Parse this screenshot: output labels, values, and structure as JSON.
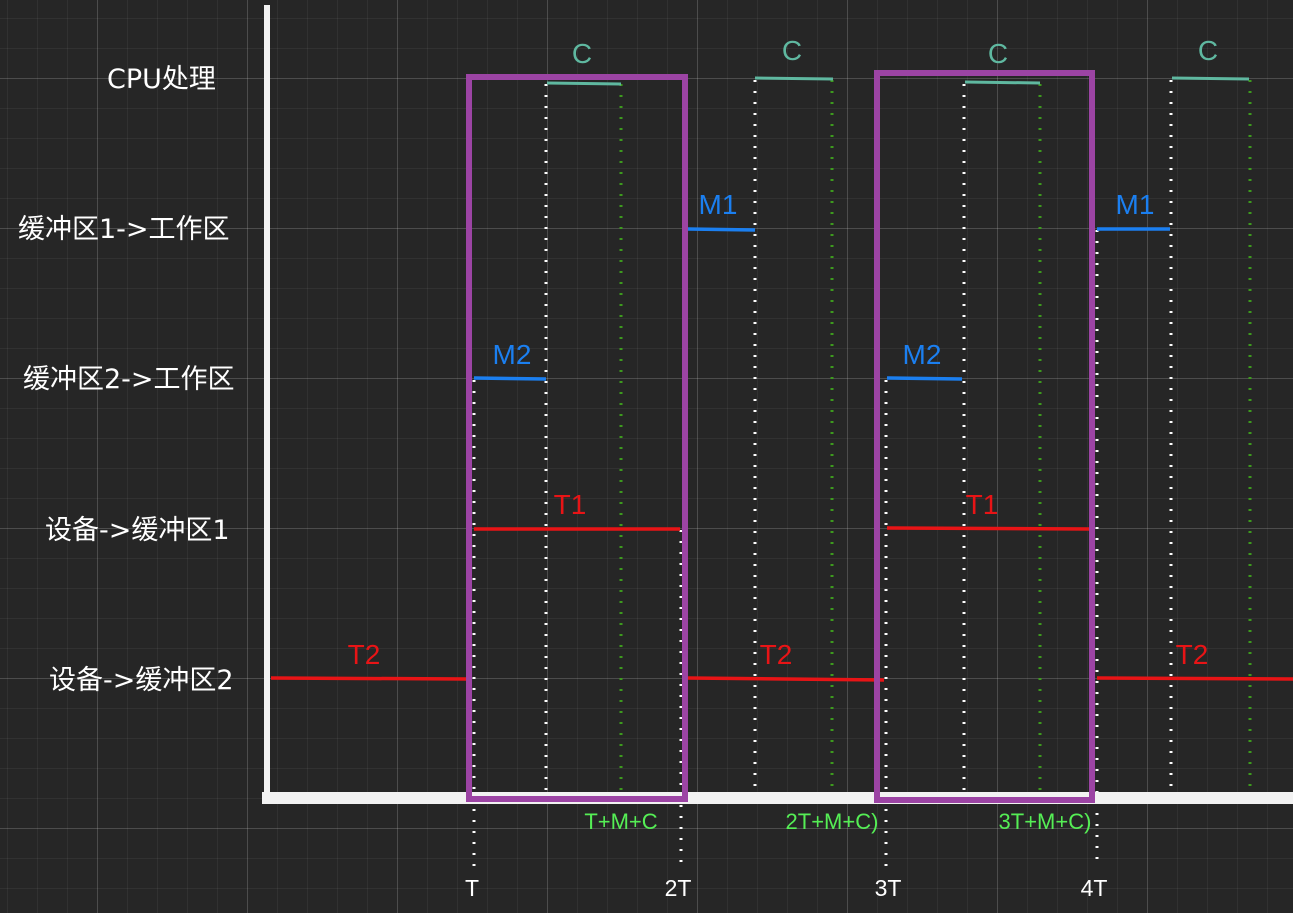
{
  "rows": {
    "cpu": "CPU处理",
    "buf1_work": "缓冲区1->工作区",
    "buf2_work": "缓冲区2->工作区",
    "dev_buf1": "设备->缓冲区1",
    "dev_buf2": "设备->缓冲区2"
  },
  "segments": {
    "c": "C",
    "m1": "M1",
    "m2": "M2",
    "t1": "T1",
    "t2": "T2"
  },
  "sums": {
    "a": "T+M+C",
    "b": "2T+M+C)",
    "c": "3T+M+C)"
  },
  "ticks": {
    "t1": "T",
    "t2": "2T",
    "t3": "3T",
    "t4": "4T"
  },
  "colors": {
    "background": "#262626",
    "axis": "#f2f2f2",
    "cpu": "#5fb8a0",
    "move": "#1b7ff0",
    "transfer": "#e81416",
    "highlight": "#9c44a4",
    "sum": "#55ee55",
    "guide_white": "#ffffff",
    "guide_green": "#3d9a1e",
    "text": "#ffffff"
  }
}
